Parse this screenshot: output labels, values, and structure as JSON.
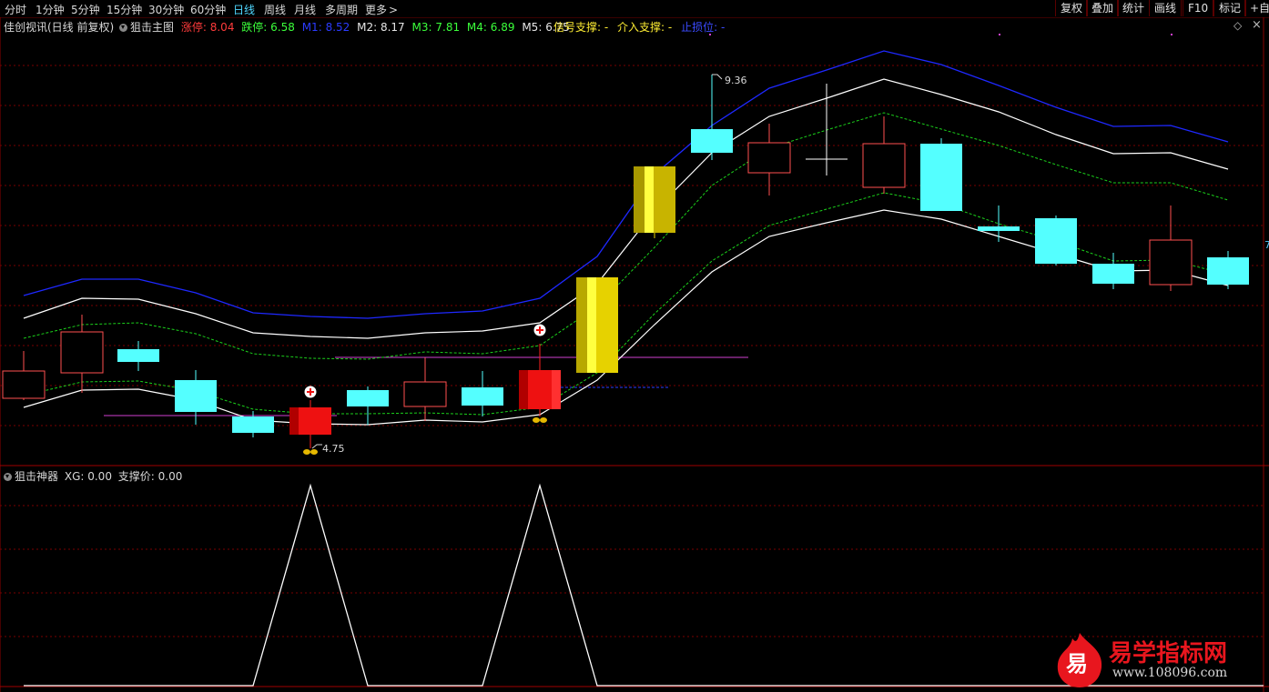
{
  "toolbar": {
    "periods": [
      "分时",
      "1分钟",
      "5分钟",
      "15分钟",
      "30分钟",
      "60分钟",
      "日线",
      "周线",
      "月线",
      "多周期",
      "更多"
    ],
    "active_period": "日线",
    "right_buttons": [
      "复权",
      "叠加",
      "统计",
      "画线",
      "F10",
      "标记",
      "+自选"
    ]
  },
  "main_panel": {
    "stock_name": "佳创视讯(日线 前复权)",
    "indicator_name": "狙击主图",
    "indicators": [
      {
        "label": "涨停:",
        "value": "8.04",
        "color": "#ff3b3b"
      },
      {
        "label": "跌停:",
        "value": "6.58",
        "color": "#3bff3b"
      },
      {
        "label": "M1:",
        "value": "8.52",
        "color": "#2b3bff"
      },
      {
        "label": "M2:",
        "value": "8.17",
        "color": "#e6e6e6"
      },
      {
        "label": "M3:",
        "value": "7.81",
        "color": "#3bff3b"
      },
      {
        "label": "M4:",
        "value": "6.89",
        "color": "#3bff3b"
      },
      {
        "label": "M5:",
        "value": "6.75",
        "color": "#e6e6e6"
      }
    ],
    "signal_support": {
      "label": "信号支撑:",
      "value": "-"
    },
    "entry_support": {
      "label": "介入支撑:",
      "value": "-"
    },
    "stop_loss": {
      "label": "止损位:",
      "value": "-"
    },
    "high_marker": "9.36",
    "low_marker": "4.75",
    "right_edge_label": "7"
  },
  "sub_panel": {
    "indicator_name": "狙击神器",
    "xg_label": "XG:",
    "xg_value": "0.00",
    "support_label": "支撑价:",
    "support_value": "0.00"
  },
  "watermark": {
    "badge": "易",
    "title": "易学指标网",
    "url": "www.108096.com"
  },
  "colors": {
    "up_candle": "#ff5050",
    "down_candle": "#54ffff",
    "m1": "#1e28ff",
    "m2": "#ffffff",
    "m3": "#1bd01b",
    "grid": "#8a0000",
    "signal": "#ff2020",
    "gold": "#ffee33"
  }
}
